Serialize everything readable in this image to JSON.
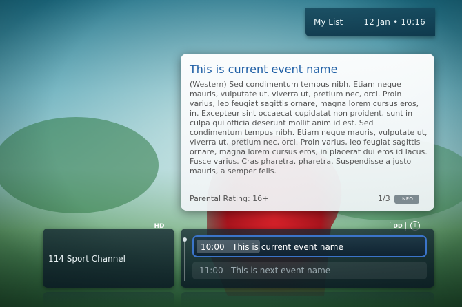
{
  "header": {
    "my_list_label": "My List",
    "datetime": "12 Jan • 10:16"
  },
  "event_info": {
    "title": "This is current event name",
    "description": "(Western) Sed condimentum tempus nibh. Etiam neque mauris, vulputate ut, viverra ut, pretium nec, orci. Proin varius, leo feugiat sagittis ornare, magna lorem cursus eros, in. Excepteur sint occaecat cupidatat non proident, sunt in culpa qui officia deserunt mollit anim id est. Sed condimentum tempus nibh. Etiam neque mauris, vulputate ut, viverra ut, pretium nec, orci. Proin varius, leo feugiat sagittis ornare, magna lorem cursus eros, in placerat dui eros id lacus. Fusce varius. Cras pharetra. pharetra. Suspendisse a justo mauris, a semper felis.",
    "parental_rating": "Parental Rating: 16+",
    "page_indicator": "1/3",
    "info_button_label": "INFO"
  },
  "channel": {
    "badge": "HD",
    "name": "114  Sport Channel"
  },
  "schedule": {
    "audio_badge": "DD",
    "info_icon": "i",
    "current": {
      "time": "10:00",
      "name": "This is current event name",
      "progress": 0.28
    },
    "next": {
      "time": "11:00",
      "name": "This is next event name"
    }
  },
  "colors": {
    "accent": "#3b74c9",
    "title": "#1f5fa5",
    "panel": "#14323f"
  }
}
